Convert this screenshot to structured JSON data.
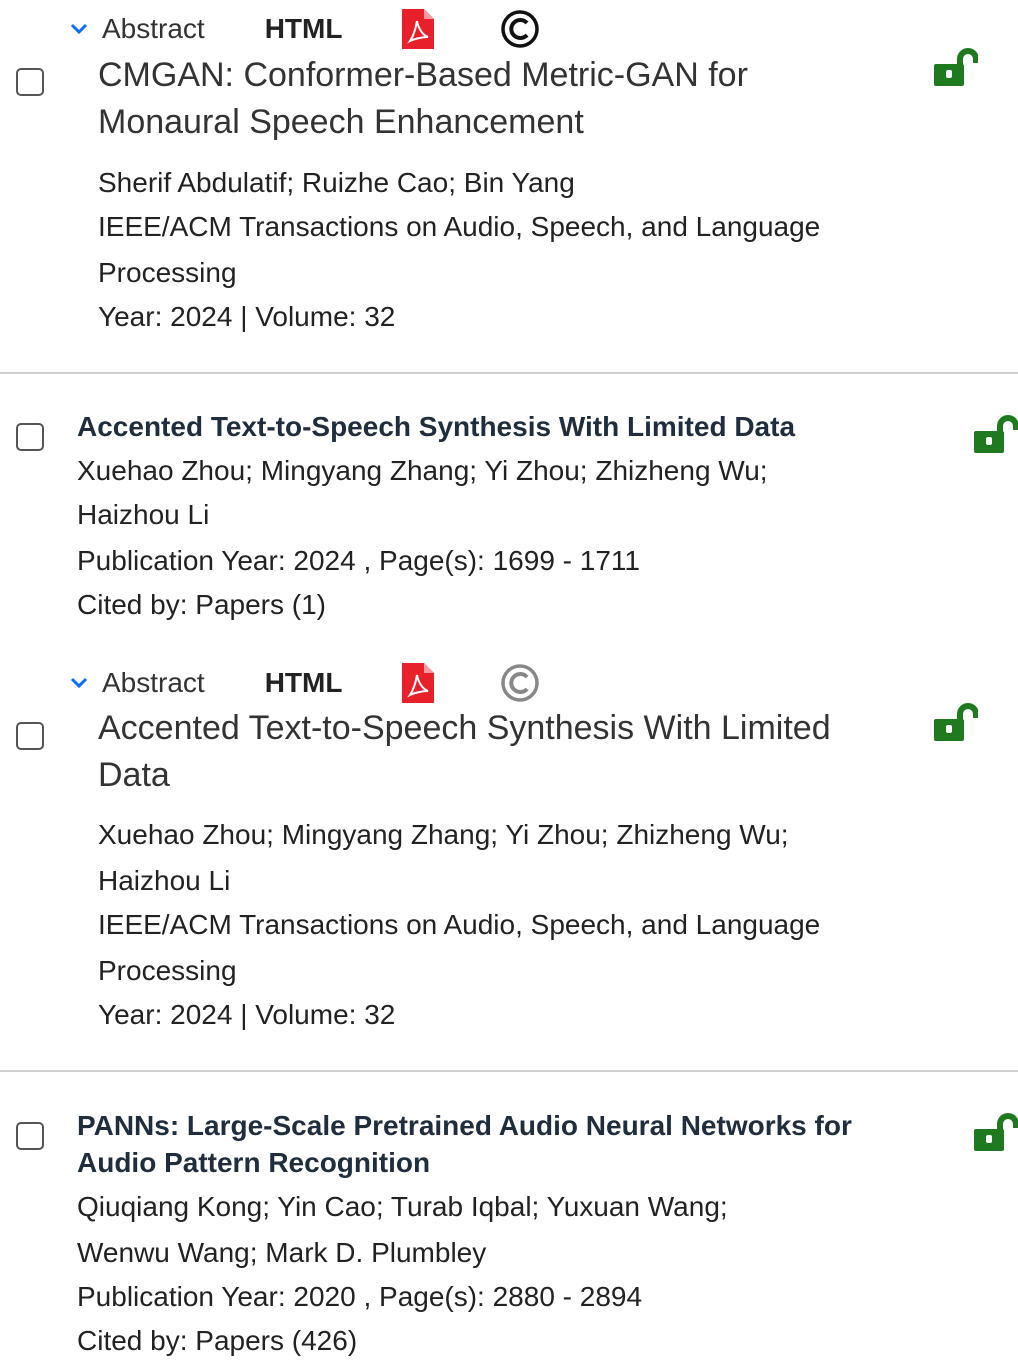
{
  "colors": {
    "lock_green": "#1f7a1f",
    "pdf_red": "#e8202a"
  },
  "icons": {
    "chevron": "chevron-down-icon",
    "pdf": "pdf-icon",
    "copyright": "copyright-icon",
    "lock": "unlocked-icon"
  },
  "actions1": {
    "abstract": "Abstract",
    "html": "HTML"
  },
  "item1": {
    "title_line1": "CMGAN: Conformer-Based Metric-GAN for",
    "title_line2": "Monaural Speech Enhancement",
    "authors": "Sherif Abdulatif; Ruizhe Cao; Bin Yang",
    "journal_line1": "IEEE/ACM Transactions on Audio, Speech, and Language",
    "journal_line2": "Processing",
    "meta": "Year: 2024  | Volume: 32"
  },
  "item2": {
    "title": "Accented Text-to-Speech Synthesis With Limited Data",
    "authors_line1": "Xuehao Zhou; Mingyang Zhang; Yi Zhou; Zhizheng Wu;",
    "authors_line2": "Haizhou Li",
    "pub": "Publication Year: 2024 , Page(s): 1699  -  1711",
    "cited": "Cited by: Papers (1)"
  },
  "actions2": {
    "abstract": "Abstract",
    "html": "HTML"
  },
  "item3": {
    "title_line1": "Accented Text-to-Speech Synthesis With Limited",
    "title_line2": "Data",
    "authors_line1": "Xuehao Zhou; Mingyang Zhang; Yi Zhou; Zhizheng Wu;",
    "authors_line2": "Haizhou Li",
    "journal_line1": "IEEE/ACM Transactions on Audio, Speech, and Language",
    "journal_line2": "Processing",
    "meta": "Year: 2024  | Volume: 32"
  },
  "item4": {
    "title_line1": "PANNs: Large-Scale Pretrained Audio Neural Networks for",
    "title_line2": "Audio Pattern Recognition",
    "authors_line1": "Qiuqiang Kong; Yin Cao; Turab Iqbal; Yuxuan Wang;",
    "authors_line2": "Wenwu Wang; Mark D. Plumbley",
    "pub": "Publication Year: 2020 , Page(s): 2880  -  2894",
    "cited": "Cited by: Papers (426)"
  }
}
